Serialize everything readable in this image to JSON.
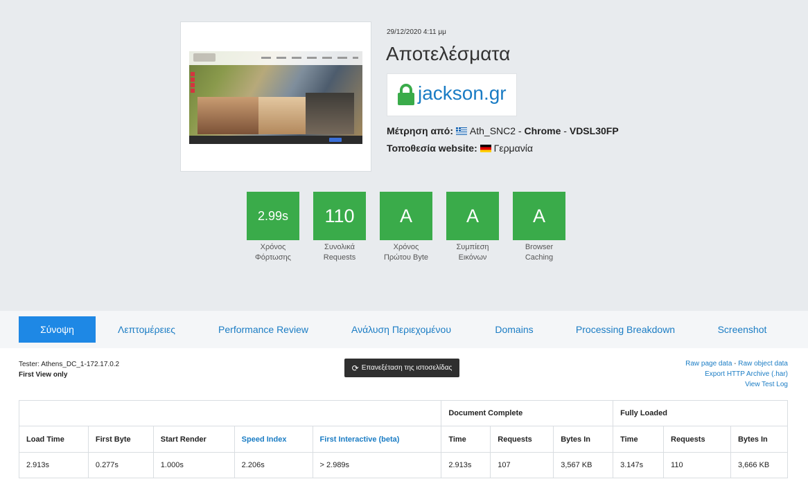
{
  "header": {
    "date": "29/12/2020 4:11 μμ",
    "title": "Αποτελέσματα",
    "site": "jackson.gr",
    "measured_from_label": "Μέτρηση από:",
    "location_name": "Ath_SNC2",
    "browser": "Chrome",
    "connection": "VDSL30FP",
    "sep": " - ",
    "website_location_label": "Τοποθεσία website:",
    "website_country": "Γερμανία"
  },
  "grades": [
    {
      "value": "2.99s",
      "label1": "Χρόνος",
      "label2": "Φόρτωσης"
    },
    {
      "value": "110",
      "label1": "Συνολικά",
      "label2": "Requests"
    },
    {
      "value": "A",
      "label1": "Χρόνος",
      "label2": "Πρώτου Byte"
    },
    {
      "value": "A",
      "label1": "Συμπίεση",
      "label2": "Εικόνων"
    },
    {
      "value": "A",
      "label1": "Browser",
      "label2": "Caching"
    }
  ],
  "grade_color": "#3aab4a",
  "tabs": [
    "Σύνοψη",
    "Λεπτομέρειες",
    "Performance Review",
    "Ανάλυση Περιεχομένου",
    "Domains",
    "Processing Breakdown",
    "Screenshot"
  ],
  "tester": {
    "line1": "Tester: Athens_DC_1-172.17.0.2",
    "line2": "First View only",
    "retest_icon": "refresh-icon",
    "retest_label": "Επανεξέταση της ιστοσελίδας"
  },
  "links": {
    "raw_page": "Raw page data",
    "sep": " - ",
    "raw_object": "Raw object data",
    "export_har": "Export HTTP Archive (.har)",
    "test_log": "View Test Log"
  },
  "table": {
    "group_doc": "Document Complete",
    "group_full": "Fully Loaded",
    "headers": [
      "Load Time",
      "First Byte",
      "Start Render",
      "Speed Index",
      "First Interactive (beta)",
      "Time",
      "Requests",
      "Bytes In",
      "Time",
      "Requests",
      "Bytes In"
    ],
    "row": [
      "2.913s",
      "0.277s",
      "1.000s",
      "2.206s",
      "> 2.989s",
      "2.913s",
      "107",
      "3,567 KB",
      "3.147s",
      "110",
      "3,666 KB"
    ]
  },
  "colors": {
    "accent": "#1e88e5",
    "link": "#1a7cc4",
    "hero_bg": "#e8ebee",
    "dark_button": "#2f2f2f"
  }
}
